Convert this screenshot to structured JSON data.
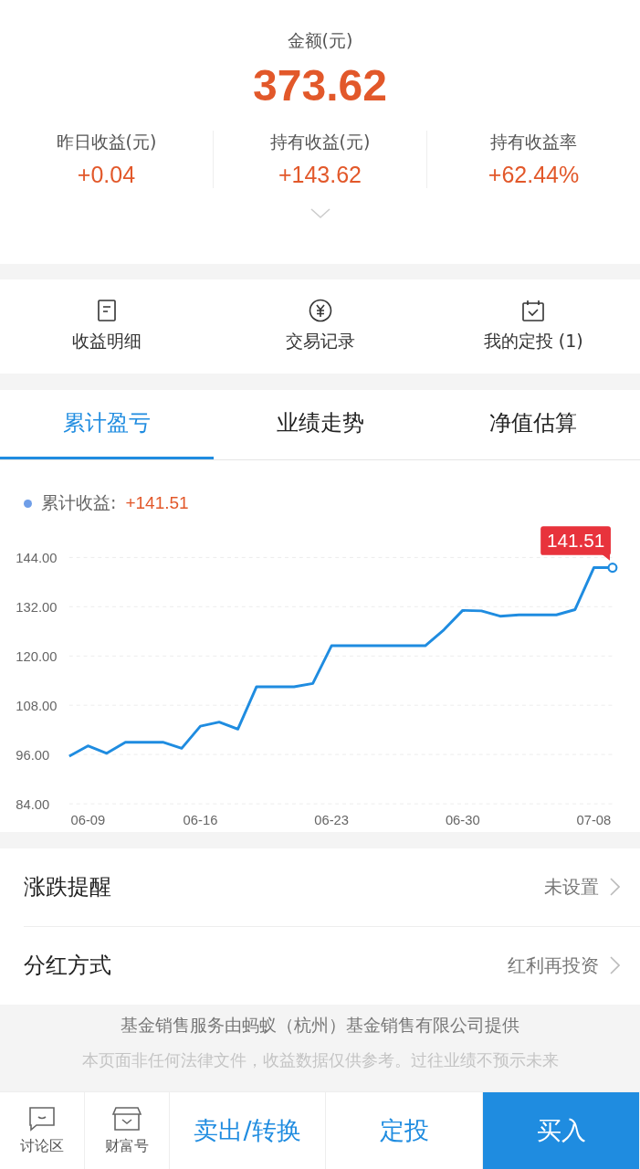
{
  "summary": {
    "label": "金额(元)",
    "amount": "373.62",
    "stats": [
      {
        "label": "昨日收益(元)",
        "value": "+0.04"
      },
      {
        "label": "持有收益(元)",
        "value": "+143.62"
      },
      {
        "label": "持有收益率",
        "value": "+62.44%"
      }
    ]
  },
  "actions": [
    {
      "kind": "list",
      "label": "收益明细"
    },
    {
      "kind": "yuan",
      "label": "交易记录"
    },
    {
      "kind": "calendar",
      "label": "我的定投 (1)"
    }
  ],
  "tabs": [
    {
      "label": "累计盈亏",
      "selected": true
    },
    {
      "label": "业绩走势",
      "selected": false
    },
    {
      "label": "净值估算",
      "selected": false
    }
  ],
  "chart": {
    "legend_value": "+141.51",
    "tooltip": "141.51",
    "chart_data": {
      "type": "line",
      "categories": [
        null,
        "06-09",
        null,
        null,
        null,
        null,
        null,
        "06-16",
        null,
        null,
        null,
        null,
        null,
        null,
        "06-23",
        null,
        null,
        null,
        null,
        null,
        null,
        "06-30",
        null,
        null,
        null,
        null,
        null,
        null,
        "07-08",
        null
      ],
      "series": [
        {
          "name": "累计收益:",
          "color": "#1f8ce0",
          "values": [
            95.6,
            98.1,
            96.3,
            99.0,
            99.0,
            99.0,
            97.5,
            102.9,
            103.9,
            102.2,
            112.5,
            112.5,
            112.5,
            113.3,
            122.5,
            122.5,
            122.5,
            122.5,
            122.5,
            122.5,
            126.4,
            131.1,
            131.0,
            129.7,
            130.0,
            130.0,
            130.0,
            131.3,
            141.5,
            141.5
          ]
        }
      ],
      "ylim": [
        84,
        144
      ],
      "yticks": [
        {
          "value": 144,
          "label": "144.00"
        },
        {
          "value": 132,
          "label": "132.00"
        },
        {
          "value": 120,
          "label": "120.00"
        },
        {
          "value": 108,
          "label": "108.00"
        },
        {
          "value": 96,
          "label": "96.00"
        },
        {
          "value": 84,
          "label": "84.00"
        }
      ],
      "grid": true
    }
  },
  "settings": [
    {
      "label": "涨跌提醒",
      "value": "未设置"
    },
    {
      "label": "分红方式",
      "value": "红利再投资"
    }
  ],
  "footer": {
    "provider": "基金销售服务由蚂蚁（杭州）基金销售有限公司提供",
    "disclaimer": "本页面非任何法律文件，收益数据仅供参考。过往业绩不预示未来"
  },
  "bottom_bar": [
    {
      "kind": "chat",
      "label": "讨论区"
    },
    {
      "kind": "store",
      "label": "财富号"
    },
    {
      "kind": "text",
      "label": "卖出/转换"
    },
    {
      "kind": "text",
      "label": "定投"
    },
    {
      "kind": "primary",
      "label": "买入"
    }
  ]
}
